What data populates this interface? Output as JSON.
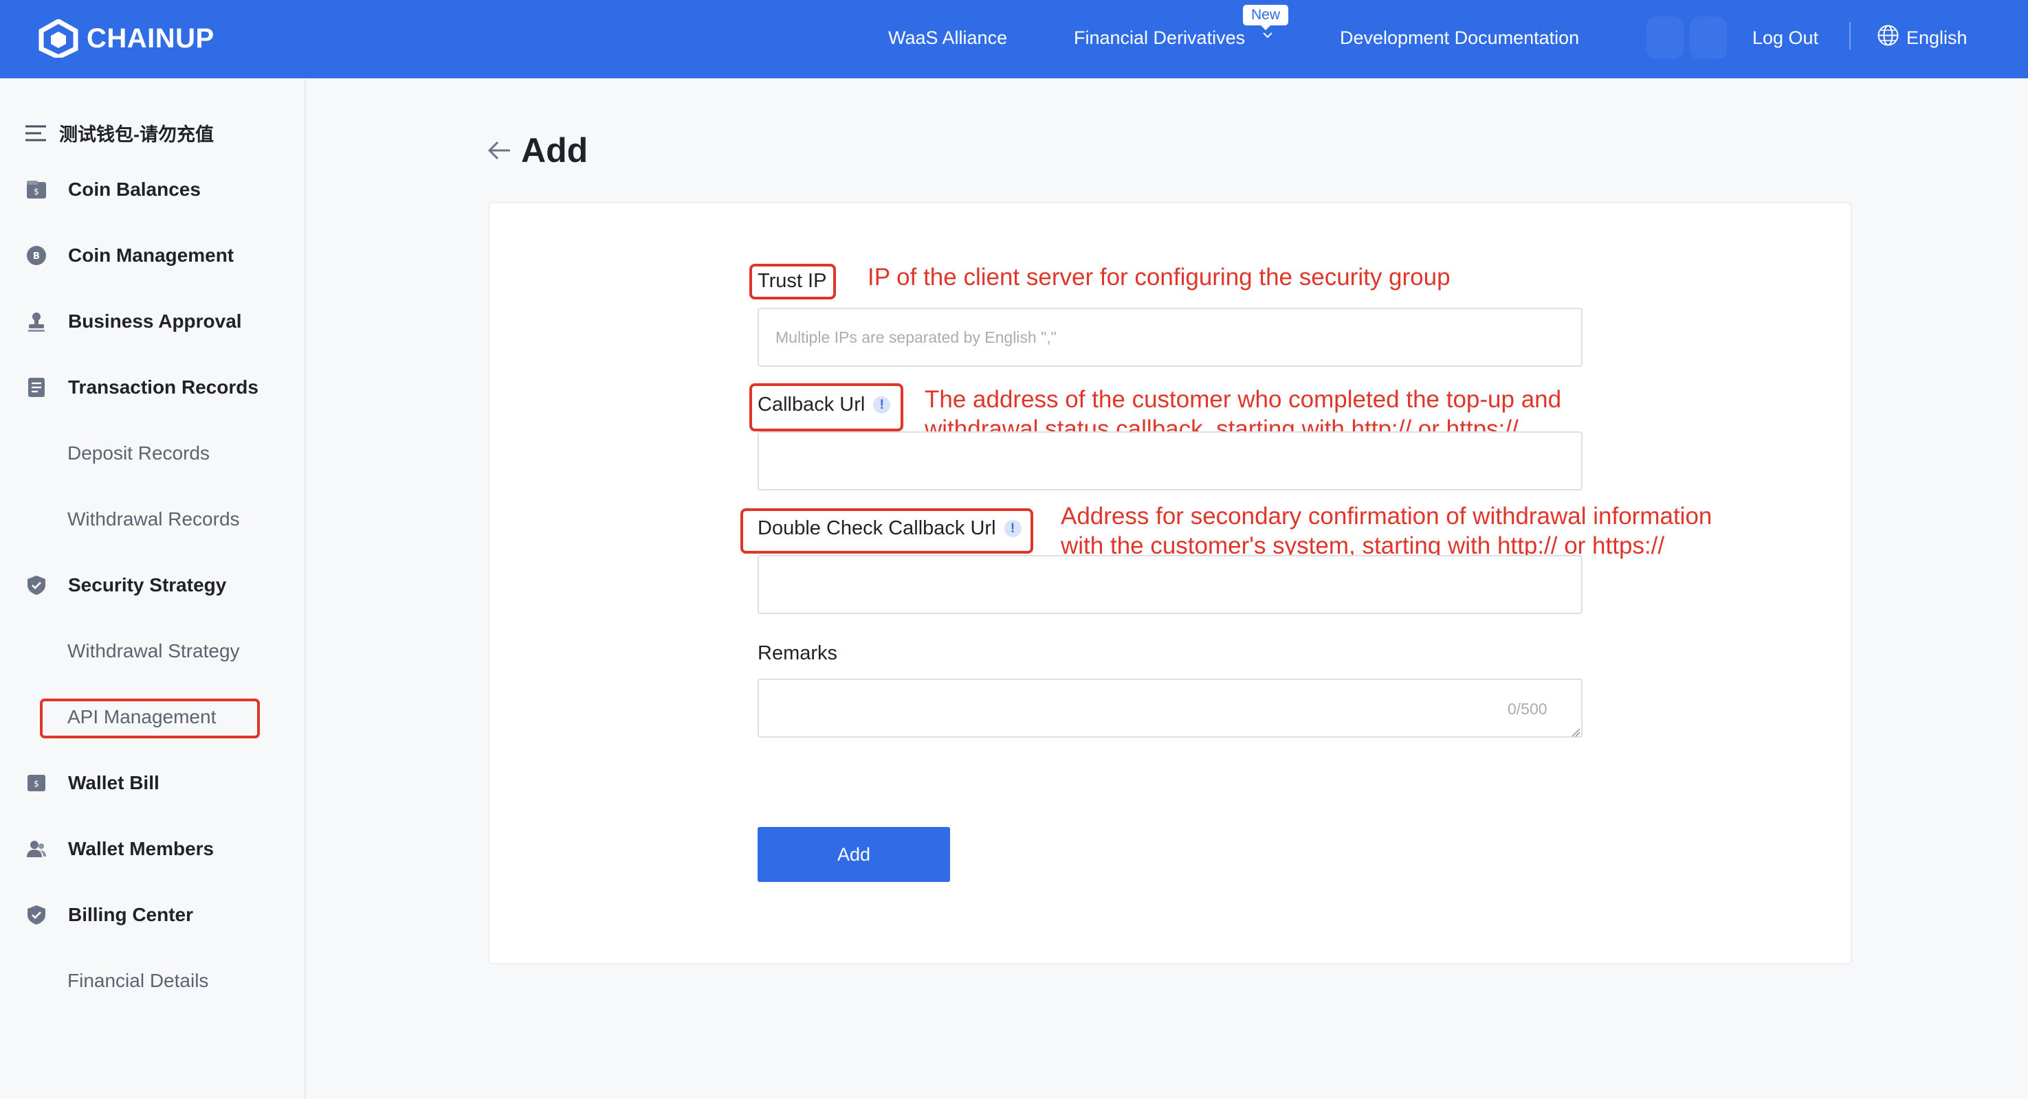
{
  "header": {
    "logo_text": "CHAINUP",
    "nav": {
      "waas": "WaaS Alliance",
      "financial": "Financial Derivatives",
      "financial_badge": "New",
      "docs": "Development Documentation",
      "logout": "Log Out",
      "language": "English"
    },
    "brand_color": "#2f6ce5"
  },
  "sidebar": {
    "wallet_name": "测试钱包-请勿充值",
    "items": [
      {
        "label": "Coin Balances",
        "icon": "wallet-icon"
      },
      {
        "label": "Coin Management",
        "icon": "coin-icon"
      },
      {
        "label": "Business Approval",
        "icon": "stamp-icon"
      },
      {
        "label": "Transaction Records",
        "icon": "document-icon"
      },
      {
        "label": "Deposit Records"
      },
      {
        "label": "Withdrawal Records"
      },
      {
        "label": "Security Strategy",
        "icon": "shield-icon"
      },
      {
        "label": "Withdrawal Strategy"
      },
      {
        "label": "API Management",
        "active": true
      },
      {
        "label": "Wallet Bill",
        "icon": "bill-icon"
      },
      {
        "label": "Wallet Members",
        "icon": "members-icon"
      },
      {
        "label": "Billing Center",
        "icon": "shield-icon"
      },
      {
        "label": "Financial Details"
      }
    ]
  },
  "main": {
    "title": "Add",
    "form": {
      "trust_ip": {
        "label": "Trust IP",
        "placeholder": "Multiple IPs are separated by English \",\"",
        "annotation": "IP of the client server for configuring the security group"
      },
      "callback_url": {
        "label": "Callback Url",
        "annotation_line1": "The address of the customer who completed the top-up and",
        "annotation_line2": "withdrawal status callback, starting with http:// or https://"
      },
      "double_check_url": {
        "label": "Double Check Callback Url",
        "annotation_line1": "Address for secondary confirmation of withdrawal information",
        "annotation_line2": "with the customer's system, starting with http:// or https://"
      },
      "remarks": {
        "label": "Remarks",
        "counter": "0/500"
      },
      "submit_label": "Add"
    },
    "annotation_color": "#e0362a",
    "info_icon": "!"
  }
}
